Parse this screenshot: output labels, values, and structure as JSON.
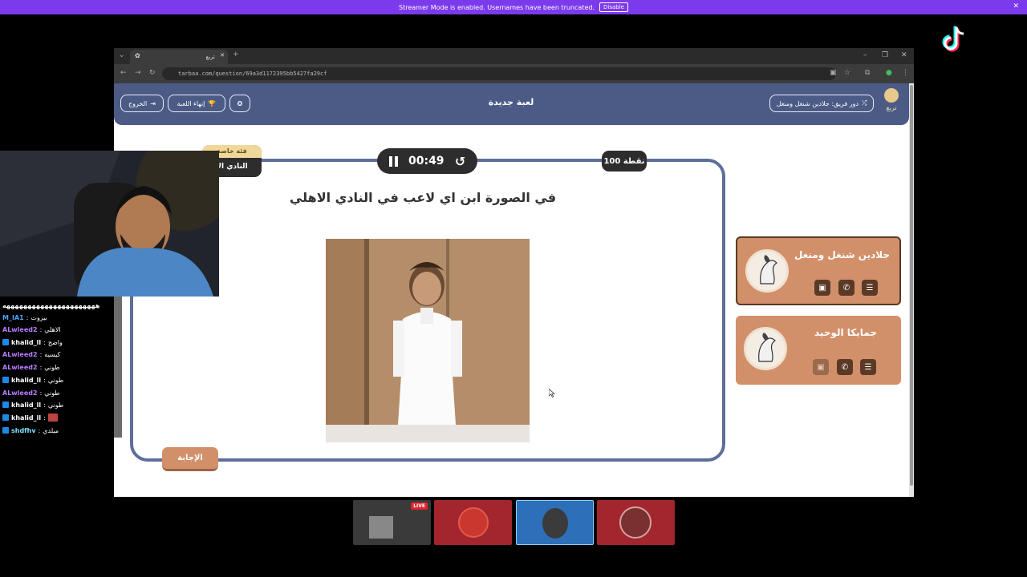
{
  "banner": {
    "text": "Streamer Mode is enabled. Usernames have been truncated.",
    "button": "Disable",
    "close": "✕"
  },
  "browser": {
    "tab_title": "تربع",
    "url": "tarbaa.com/question/69a3d1172395bb5427fa29cf",
    "window_controls": [
      "–",
      "❐",
      "✕"
    ]
  },
  "header": {
    "turn_label": "دور فريق: جلادين شنغل ومنغل",
    "title": "لعبة جديدة",
    "end_game": "إنهاء اللعبة",
    "exit": "الخروج",
    "logo_text": "تربع"
  },
  "question": {
    "category_top": "فئة خاصة",
    "category_bottom": "النادي الا",
    "timer": "00:49",
    "points": "100 نقطة",
    "text": "في الصورة ابن اي لاعب في النادي الاهلي",
    "answer_button": "الإجابة"
  },
  "teams": [
    {
      "name": "جلادين شنغل ومنغل",
      "active": true
    },
    {
      "name": "جمايكا الوحيد",
      "active": false
    }
  ],
  "chat": [
    {
      "user": "",
      "msg": "ههههههههههههههههههههههه",
      "color": "#ffffff",
      "badge": false
    },
    {
      "user": "M_IA1",
      "msg": "بيزوت",
      "color": "#4fa3ff",
      "badge": false
    },
    {
      "user": "ALwleed2",
      "msg": "الاهلي",
      "color": "#b57cff",
      "badge": false
    },
    {
      "user": "khalid_ll",
      "msg": "واضح",
      "color": "#ffffff",
      "badge": true
    },
    {
      "user": "ALwleed2",
      "msg": "كيسيه",
      "color": "#b57cff",
      "badge": false
    },
    {
      "user": "ALwleed2",
      "msg": "طوني",
      "color": "#b57cff",
      "badge": false
    },
    {
      "user": "khalid_ll",
      "msg": "طوني",
      "color": "#ffffff",
      "badge": true
    },
    {
      "user": "ALwleed2",
      "msg": "طوني",
      "color": "#b57cff",
      "badge": false
    },
    {
      "user": "khalid_ll",
      "msg": "طوني",
      "color": "#ffffff",
      "badge": true
    },
    {
      "user": "khalid_ll",
      "msg": "",
      "color": "#ffffff",
      "badge": true
    },
    {
      "user": "shdfhv",
      "msg": "ميلدي",
      "color": "#7de2ff",
      "badge": true
    }
  ],
  "thumbnails": [
    {
      "label": "LIVE",
      "bg": "#3a3a3a"
    },
    {
      "label": "",
      "bg": "#a3262f"
    },
    {
      "label": "",
      "bg": "#2d6fb8"
    },
    {
      "label": "",
      "bg": "#a3262f"
    }
  ]
}
